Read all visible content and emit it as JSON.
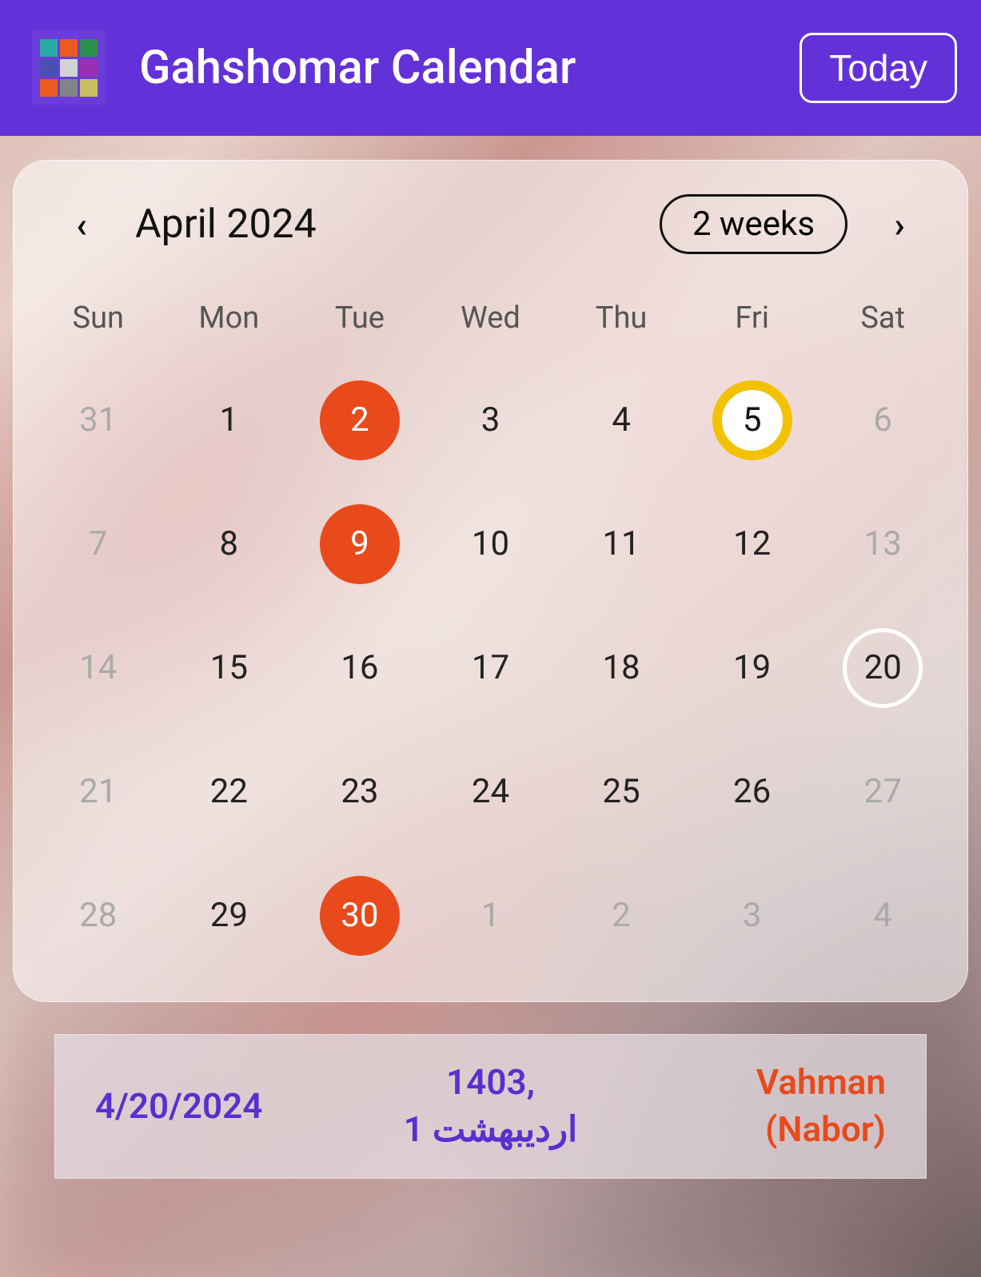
{
  "header": {
    "title": "Gahshomar Calendar",
    "today_button": "Today"
  },
  "calendar": {
    "month_label": "April 2024",
    "view_mode": "2 weeks",
    "prev_icon": "‹",
    "next_icon": "›",
    "dow": [
      "Sun",
      "Mon",
      "Tue",
      "Wed",
      "Thu",
      "Fri",
      "Sat"
    ],
    "days": [
      {
        "n": "31",
        "muted": true
      },
      {
        "n": "1"
      },
      {
        "n": "2",
        "event": true
      },
      {
        "n": "3"
      },
      {
        "n": "4"
      },
      {
        "n": "5",
        "today": true
      },
      {
        "n": "6",
        "muted": true
      },
      {
        "n": "7",
        "muted": true
      },
      {
        "n": "8"
      },
      {
        "n": "9",
        "event": true
      },
      {
        "n": "10"
      },
      {
        "n": "11"
      },
      {
        "n": "12"
      },
      {
        "n": "13",
        "muted": true
      },
      {
        "n": "14",
        "muted": true
      },
      {
        "n": "15"
      },
      {
        "n": "16"
      },
      {
        "n": "17"
      },
      {
        "n": "18"
      },
      {
        "n": "19"
      },
      {
        "n": "20",
        "selected": true,
        "muted": true
      },
      {
        "n": "21",
        "muted": true
      },
      {
        "n": "22"
      },
      {
        "n": "23"
      },
      {
        "n": "24"
      },
      {
        "n": "25"
      },
      {
        "n": "26"
      },
      {
        "n": "27",
        "muted": true
      },
      {
        "n": "28",
        "muted": true
      },
      {
        "n": "29"
      },
      {
        "n": "30",
        "event": true
      },
      {
        "n": "1",
        "muted": true
      },
      {
        "n": "2",
        "muted": true
      },
      {
        "n": "3",
        "muted": true
      },
      {
        "n": "4",
        "muted": true
      }
    ]
  },
  "info": {
    "gregorian": "4/20/2024",
    "persian_line1": "1403,",
    "persian_line2": "اردیبهشت 1",
    "zoroastrian_line1": "Vahman",
    "zoroastrian_line2": "(Nabor)"
  }
}
